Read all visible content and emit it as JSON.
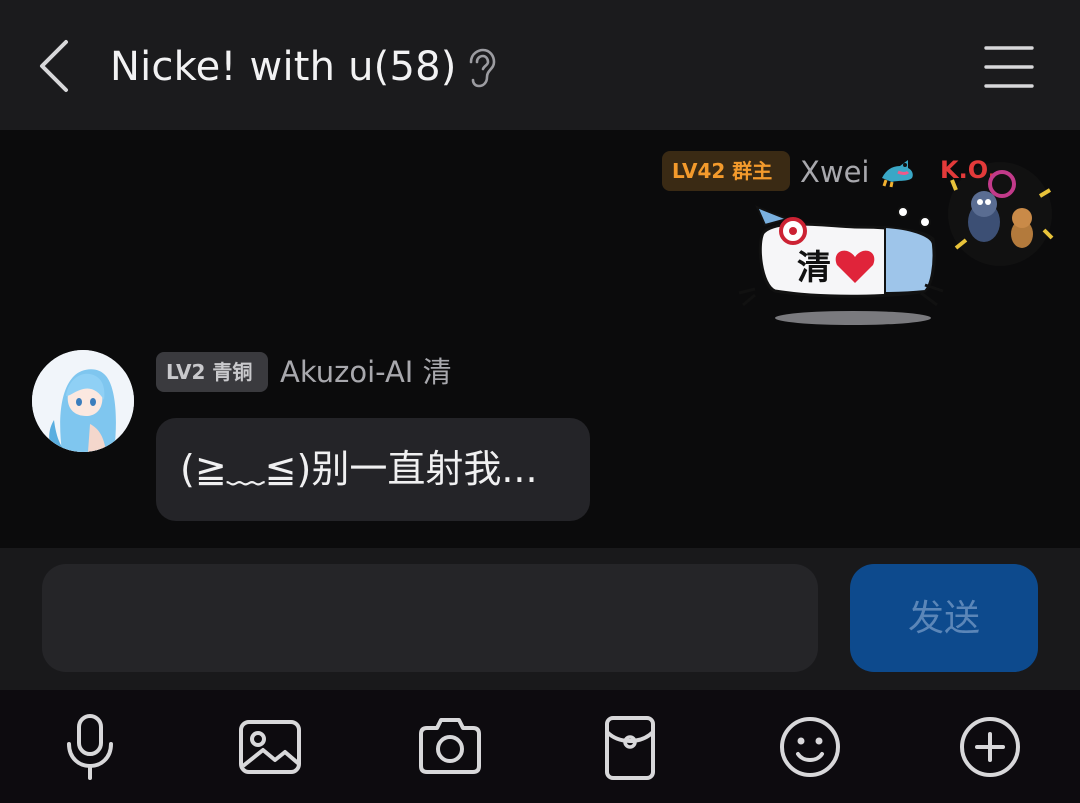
{
  "header": {
    "title": "Nicke! with u(58)",
    "back_icon": "chevron-left-icon",
    "ear_icon": "ear-icon",
    "menu_icon": "hamburger-menu-icon"
  },
  "messages": [
    {
      "side": "right",
      "badge": "LV42 群主",
      "sender": "Xwei",
      "sticker_text": "清",
      "avatar_text": "K.O."
    },
    {
      "side": "left",
      "badge": "LV2 青铜",
      "sender": "Akuzoi-AI 清",
      "text": "(≧﹏≦)别一直射我..."
    }
  ],
  "composer": {
    "placeholder": "",
    "value": "",
    "send_label": "发送"
  },
  "toolbar": {
    "items": [
      "microphone-icon",
      "image-icon",
      "camera-icon",
      "red-packet-icon",
      "emoji-icon",
      "plus-circle-icon"
    ]
  },
  "colors": {
    "owner_badge": "#f39a2c",
    "send_button": "#0d4a8d",
    "header_bg": "#1b1b1d"
  }
}
